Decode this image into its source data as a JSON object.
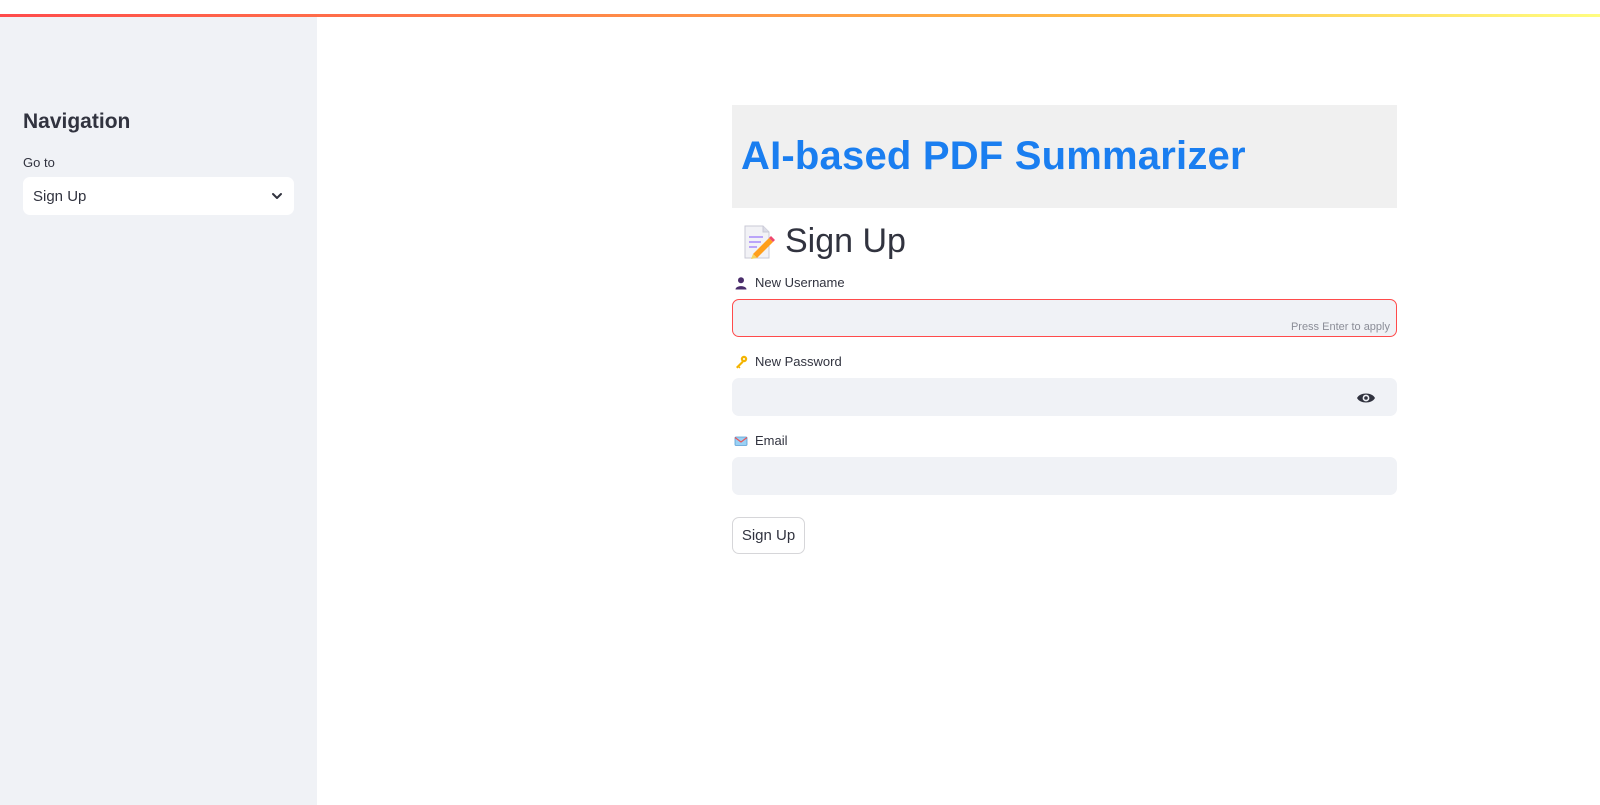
{
  "sidebar": {
    "heading": "Navigation",
    "goto_label": "Go to",
    "selected_page": "Sign Up"
  },
  "main": {
    "app_title": "AI-based PDF Summarizer",
    "page_heading": "Sign Up",
    "fields": {
      "username": {
        "label": "New Username",
        "value": "",
        "hint": "Press Enter to apply"
      },
      "password": {
        "label": "New Password",
        "value": ""
      },
      "email": {
        "label": "Email",
        "value": ""
      }
    },
    "submit_label": "Sign Up"
  },
  "icons": {
    "select": "chevron-down-icon",
    "heading": "memo-icon",
    "username": "user-silhouette-icon",
    "password": "key-icon",
    "email": "envelope-icon",
    "password_toggle": "eye-icon"
  },
  "colors": {
    "accent": "#ff4b4b",
    "title": "#1a7ef0",
    "sidebar_bg": "#f0f2f6",
    "input_bg": "#f0f2f6",
    "banner_bg": "#f0f0f0"
  }
}
